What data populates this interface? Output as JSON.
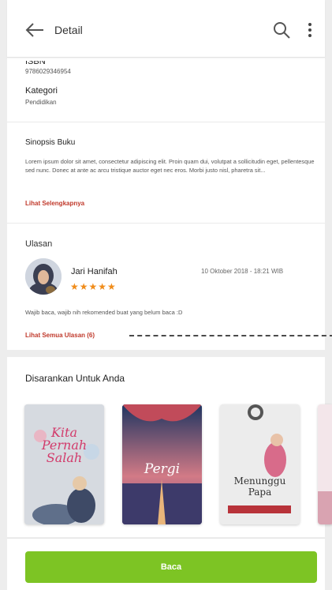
{
  "appbar": {
    "title": "Detail"
  },
  "details": {
    "isbn_label": "ISBN",
    "isbn_value": "9786029346954",
    "kategori_label": "Kategori",
    "kategori_value": "Pendidikan"
  },
  "sinopsis": {
    "title": "Sinopsis Buku",
    "text": "Lorem ipsum dolor sit amet, consectetur adipiscing elit. Proin quam dui, volutpat a sollicitudin eget, pellentesque sed nunc. Donec at ante ac arcu tristique auctor eget nec eros. Morbi justo nisl, pharetra sit...",
    "link": "Lihat Selengkapnya"
  },
  "ulasan": {
    "title": "Ulasan",
    "reviewer": "Jari Hanifah",
    "date": "10 Oktober 2018 - 18:21 WIB",
    "stars": "★★★★★",
    "rating": 5,
    "text": "Wajib baca, wajib nih rekomended buat yang belum baca :D",
    "link": "Lihat Semua Ulasan (6)"
  },
  "recommend": {
    "title": "Disarankan Untuk Anda",
    "books": [
      {
        "title": "Kita Pernah Salah"
      },
      {
        "title": "Pergi"
      },
      {
        "title": "Menunggu Papa"
      }
    ]
  },
  "bottom": {
    "button_label": "Baca"
  },
  "colors": {
    "accent_green": "#7dc424",
    "link_red": "#c0392b",
    "star_orange": "#f08c1a"
  }
}
